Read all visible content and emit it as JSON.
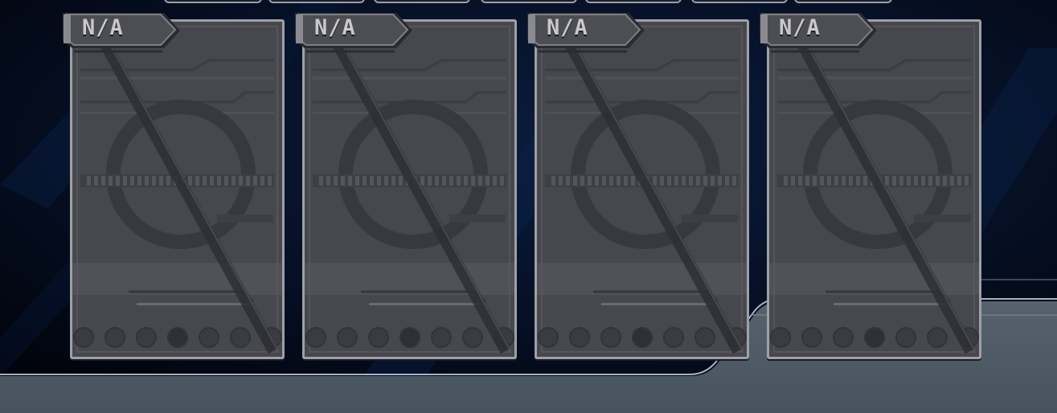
{
  "scene": {
    "colors": {
      "background": "#020712",
      "floor_panel": "#4d5a68",
      "card_face": "#47484e",
      "card_border": "#9ea0a6",
      "tag_fill": "#4d4e53",
      "tag_text": "#c9c9cc"
    }
  },
  "top_tabs": [
    {
      "name": "top-tab-1"
    },
    {
      "name": "top-tab-2"
    },
    {
      "name": "top-tab-3"
    },
    {
      "name": "top-tab-4"
    },
    {
      "name": "top-tab-5"
    },
    {
      "name": "top-tab-6"
    },
    {
      "name": "top-tab-7"
    }
  ],
  "card_slots": [
    {
      "tag": "N/A",
      "state": "empty"
    },
    {
      "tag": "N/A",
      "state": "empty"
    },
    {
      "tag": "N/A",
      "state": "empty"
    },
    {
      "tag": "N/A",
      "state": "empty"
    }
  ]
}
